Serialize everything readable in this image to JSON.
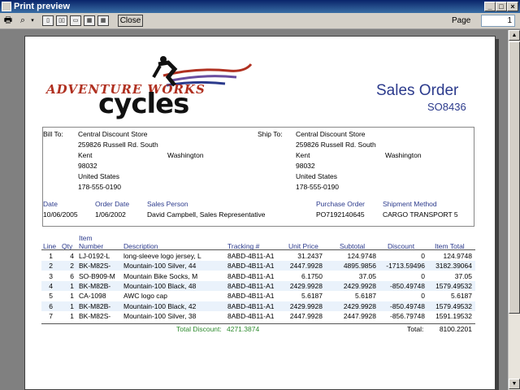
{
  "window": {
    "title": "Print preview"
  },
  "toolbar": {
    "icons": [
      "print-icon",
      "zoom-icon",
      "zoom-dropdown-icon",
      "one-page-icon",
      "two-pages-icon",
      "three-pages-icon",
      "four-pages-icon",
      "six-pages-icon"
    ],
    "close_label": "Close",
    "page_label": "Page",
    "page_value": "1"
  },
  "logo": {
    "line1": "ADVENTURE WORKS",
    "line2": "cycles"
  },
  "document": {
    "title": "Sales Order",
    "number": "SO8436"
  },
  "bill_to": {
    "label": "Bill To:",
    "name": "Central Discount Store",
    "street": "259826 Russell Rd. South",
    "city": "Kent",
    "state": "Washington",
    "zip": "98032",
    "country": "United States",
    "phone": "178-555-0190"
  },
  "ship_to": {
    "label": "Ship To:",
    "name": "Central Discount Store",
    "street": "259826 Russell Rd. South",
    "city": "Kent",
    "state": "Washington",
    "zip": "98032",
    "country": "United States",
    "phone": "178-555-0190"
  },
  "order_info": {
    "date_label": "Date",
    "date": "10/06/2005",
    "order_date_label": "Order Date",
    "order_date": "1/06/2002",
    "sales_person_label": "Sales Person",
    "sales_person": "David Campbell, Sales Representative",
    "po_label": "Purchase Order",
    "po": "PO7192140645",
    "ship_label": "Shipment Method",
    "ship": "CARGO TRANSPORT 5"
  },
  "table": {
    "headers": {
      "line": "Line",
      "qty": "Qty",
      "item_top": "Item",
      "item_bottom": "Number",
      "description": "Description",
      "tracking": "Tracking #",
      "unit_price": "Unit Price",
      "subtotal": "Subtotal",
      "discount": "Discount",
      "item_total": "Item Total"
    },
    "rows": [
      {
        "line": "1",
        "qty": "4",
        "item": "LJ-0192-L",
        "description": "long-sleeve logo jersey, L",
        "tracking": "8ABD-4B11-A1",
        "unit_price": "31.2437",
        "subtotal": "124.9748",
        "discount": "0",
        "item_total": "124.9748"
      },
      {
        "line": "2",
        "qty": "2",
        "item": "BK-M82S-",
        "description": "Mountain-100 Silver, 44",
        "tracking": "8ABD-4B11-A1",
        "unit_price": "2447.9928",
        "subtotal": "4895.9856",
        "discount": "-1713.59496",
        "item_total": "3182.39064"
      },
      {
        "line": "3",
        "qty": "6",
        "item": "SO-B909-M",
        "description": "Mountain Bike Socks, M",
        "tracking": "8ABD-4B11-A1",
        "unit_price": "6.1750",
        "subtotal": "37.05",
        "discount": "0",
        "item_total": "37.05"
      },
      {
        "line": "4",
        "qty": "1",
        "item": "BK-M82B-",
        "description": "Mountain-100 Black, 48",
        "tracking": "8ABD-4B11-A1",
        "unit_price": "2429.9928",
        "subtotal": "2429.9928",
        "discount": "-850.49748",
        "item_total": "1579.49532"
      },
      {
        "line": "5",
        "qty": "1",
        "item": "CA-1098",
        "description": "AWC logo cap",
        "tracking": "8ABD-4B11-A1",
        "unit_price": "5.6187",
        "subtotal": "5.6187",
        "discount": "0",
        "item_total": "5.6187"
      },
      {
        "line": "6",
        "qty": "1",
        "item": "BK-M82B-",
        "description": "Mountain-100 Black, 42",
        "tracking": "8ABD-4B11-A1",
        "unit_price": "2429.9928",
        "subtotal": "2429.9928",
        "discount": "-850.49748",
        "item_total": "1579.49532"
      },
      {
        "line": "7",
        "qty": "1",
        "item": "BK-M82S-",
        "description": "Mountain-100 Silver, 38",
        "tracking": "8ABD-4B11-A1",
        "unit_price": "2447.9928",
        "subtotal": "2447.9928",
        "discount": "-856.79748",
        "item_total": "1591.19532"
      }
    ],
    "total_discount_label": "Total Discount:",
    "total_discount": "4271.3874",
    "total_label": "Total:",
    "total": "8100.2201"
  },
  "colors": {
    "accent_blue": "#2b3a8c",
    "discount_green": "#2e8b2e",
    "logo_red": "#b03020"
  }
}
